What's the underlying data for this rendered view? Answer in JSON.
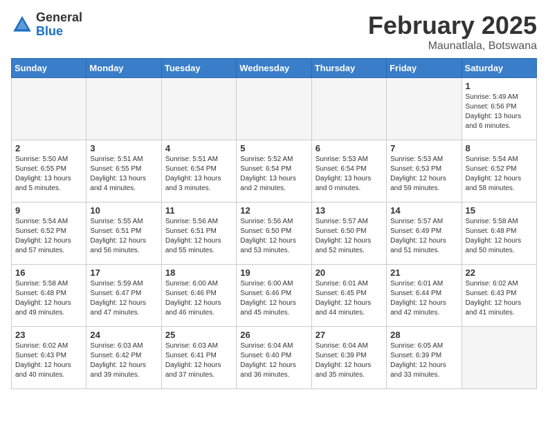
{
  "header": {
    "logo_general": "General",
    "logo_blue": "Blue",
    "month_title": "February 2025",
    "location": "Maunatlala, Botswana"
  },
  "weekdays": [
    "Sunday",
    "Monday",
    "Tuesday",
    "Wednesday",
    "Thursday",
    "Friday",
    "Saturday"
  ],
  "weeks": [
    [
      {
        "day": "",
        "empty": true
      },
      {
        "day": "",
        "empty": true
      },
      {
        "day": "",
        "empty": true
      },
      {
        "day": "",
        "empty": true
      },
      {
        "day": "",
        "empty": true
      },
      {
        "day": "",
        "empty": true
      },
      {
        "day": "1",
        "sunrise": "5:49 AM",
        "sunset": "6:56 PM",
        "daylight": "13 hours and 6 minutes."
      }
    ],
    [
      {
        "day": "2",
        "sunrise": "5:50 AM",
        "sunset": "6:55 PM",
        "daylight": "13 hours and 5 minutes."
      },
      {
        "day": "3",
        "sunrise": "5:51 AM",
        "sunset": "6:55 PM",
        "daylight": "13 hours and 4 minutes."
      },
      {
        "day": "4",
        "sunrise": "5:51 AM",
        "sunset": "6:54 PM",
        "daylight": "13 hours and 3 minutes."
      },
      {
        "day": "5",
        "sunrise": "5:52 AM",
        "sunset": "6:54 PM",
        "daylight": "13 hours and 2 minutes."
      },
      {
        "day": "6",
        "sunrise": "5:53 AM",
        "sunset": "6:54 PM",
        "daylight": "13 hours and 0 minutes."
      },
      {
        "day": "7",
        "sunrise": "5:53 AM",
        "sunset": "6:53 PM",
        "daylight": "12 hours and 59 minutes."
      },
      {
        "day": "8",
        "sunrise": "5:54 AM",
        "sunset": "6:52 PM",
        "daylight": "12 hours and 58 minutes."
      }
    ],
    [
      {
        "day": "9",
        "sunrise": "5:54 AM",
        "sunset": "6:52 PM",
        "daylight": "12 hours and 57 minutes."
      },
      {
        "day": "10",
        "sunrise": "5:55 AM",
        "sunset": "6:51 PM",
        "daylight": "12 hours and 56 minutes."
      },
      {
        "day": "11",
        "sunrise": "5:56 AM",
        "sunset": "6:51 PM",
        "daylight": "12 hours and 55 minutes."
      },
      {
        "day": "12",
        "sunrise": "5:56 AM",
        "sunset": "6:50 PM",
        "daylight": "12 hours and 53 minutes."
      },
      {
        "day": "13",
        "sunrise": "5:57 AM",
        "sunset": "6:50 PM",
        "daylight": "12 hours and 52 minutes."
      },
      {
        "day": "14",
        "sunrise": "5:57 AM",
        "sunset": "6:49 PM",
        "daylight": "12 hours and 51 minutes."
      },
      {
        "day": "15",
        "sunrise": "5:58 AM",
        "sunset": "6:48 PM",
        "daylight": "12 hours and 50 minutes."
      }
    ],
    [
      {
        "day": "16",
        "sunrise": "5:58 AM",
        "sunset": "6:48 PM",
        "daylight": "12 hours and 49 minutes."
      },
      {
        "day": "17",
        "sunrise": "5:59 AM",
        "sunset": "6:47 PM",
        "daylight": "12 hours and 47 minutes."
      },
      {
        "day": "18",
        "sunrise": "6:00 AM",
        "sunset": "6:46 PM",
        "daylight": "12 hours and 46 minutes."
      },
      {
        "day": "19",
        "sunrise": "6:00 AM",
        "sunset": "6:46 PM",
        "daylight": "12 hours and 45 minutes."
      },
      {
        "day": "20",
        "sunrise": "6:01 AM",
        "sunset": "6:45 PM",
        "daylight": "12 hours and 44 minutes."
      },
      {
        "day": "21",
        "sunrise": "6:01 AM",
        "sunset": "6:44 PM",
        "daylight": "12 hours and 42 minutes."
      },
      {
        "day": "22",
        "sunrise": "6:02 AM",
        "sunset": "6:43 PM",
        "daylight": "12 hours and 41 minutes."
      }
    ],
    [
      {
        "day": "23",
        "sunrise": "6:02 AM",
        "sunset": "6:43 PM",
        "daylight": "12 hours and 40 minutes."
      },
      {
        "day": "24",
        "sunrise": "6:03 AM",
        "sunset": "6:42 PM",
        "daylight": "12 hours and 39 minutes."
      },
      {
        "day": "25",
        "sunrise": "6:03 AM",
        "sunset": "6:41 PM",
        "daylight": "12 hours and 37 minutes."
      },
      {
        "day": "26",
        "sunrise": "6:04 AM",
        "sunset": "6:40 PM",
        "daylight": "12 hours and 36 minutes."
      },
      {
        "day": "27",
        "sunrise": "6:04 AM",
        "sunset": "6:39 PM",
        "daylight": "12 hours and 35 minutes."
      },
      {
        "day": "28",
        "sunrise": "6:05 AM",
        "sunset": "6:39 PM",
        "daylight": "12 hours and 33 minutes."
      },
      {
        "day": "",
        "empty": true
      }
    ]
  ]
}
